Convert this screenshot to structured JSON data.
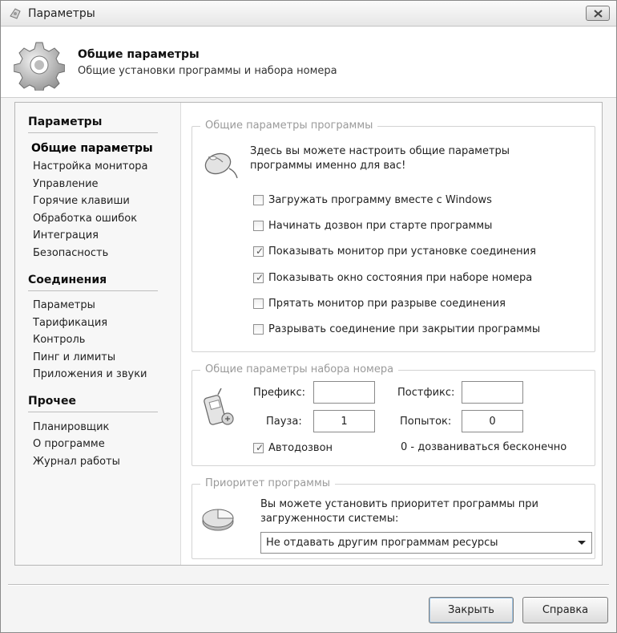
{
  "window": {
    "title": "Параметры"
  },
  "header": {
    "title": "Общие параметры",
    "subtitle": "Общие установки программы и набора номера"
  },
  "sidebar": {
    "sections": [
      {
        "title": "Параметры",
        "items": [
          "Общие параметры",
          "Настройка монитора",
          "Управление",
          "Горячие клавиши",
          "Обработка ошибок",
          "Интеграция",
          "Безопасность"
        ]
      },
      {
        "title": "Соединения",
        "items": [
          "Параметры",
          "Тарификация",
          "Контроль",
          "Пинг и лимиты",
          "Приложения и звуки"
        ]
      },
      {
        "title": "Прочее",
        "items": [
          "Планировщик",
          "О программе",
          "Журнал работы"
        ]
      }
    ],
    "active_item": "Общие параметры"
  },
  "program_group": {
    "legend": "Общие параметры программы",
    "desc_line1": "Здесь вы можете настроить общие параметры",
    "desc_line2": "программы именно для вас!",
    "checkboxes": [
      {
        "label": "Загружать программу вместе с Windows",
        "checked": false
      },
      {
        "label": "Начинать дозвон при старте программы",
        "checked": false
      },
      {
        "label": "Показывать монитор при установке соединения",
        "checked": true
      },
      {
        "label": "Показывать окно состояния при наборе номера",
        "checked": true
      },
      {
        "label": "Прятать монитор при разрыве соединения",
        "checked": false
      },
      {
        "label": "Разрывать соединение при закрытии программы",
        "checked": false
      }
    ]
  },
  "dial_group": {
    "legend": "Общие параметры набора номера",
    "prefix_label": "Префикс:",
    "prefix_value": "",
    "postfix_label": "Постфикс:",
    "postfix_value": "",
    "pause_label": "Пауза:",
    "pause_value": "1",
    "attempts_label": "Попыток:",
    "attempts_value": "0",
    "autodial_label": "Автодозвон",
    "autodial_checked": true,
    "infinite_note": "0 - дозваниваться бесконечно"
  },
  "priority_group": {
    "legend": "Приоритет программы",
    "desc_line1": "Вы можете установить приоритет программы при",
    "desc_line2": "загруженности системы:",
    "selected": "Не отдавать другим программам ресурсы"
  },
  "buttons": {
    "close": "Закрыть",
    "help": "Справка"
  },
  "check_glyph": "✓"
}
